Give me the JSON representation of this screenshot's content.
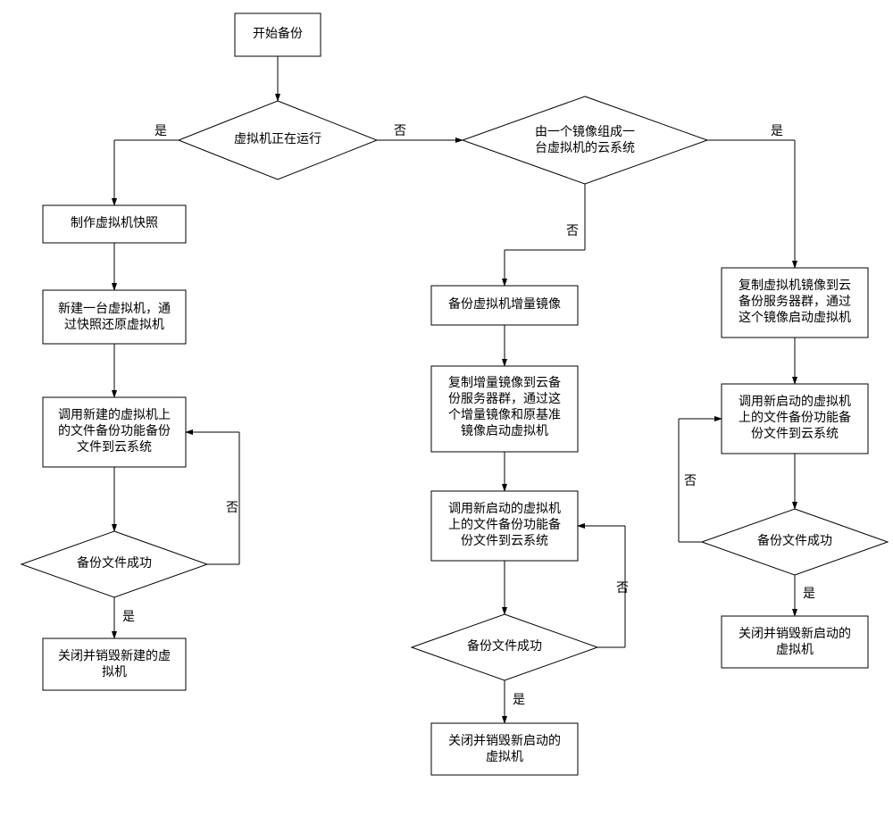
{
  "start": "开始备份",
  "d1": "虚拟机正在运行",
  "d2_line1": "由一个镜像组成一",
  "d2_line2": "台虚拟机的云系统",
  "yes": "是",
  "no": "否",
  "left": {
    "b1": "制作虚拟机快照",
    "b2_l1": "新建一台虚拟机，通",
    "b2_l2": "过快照还原虚拟机",
    "b3_l1": "调用新建的虚拟机上",
    "b3_l2": "的文件备份功能备份",
    "b3_l3": "文件到云系统",
    "d": "备份文件成功",
    "b4_l1": "关闭并销毁新建的虚",
    "b4_l2": "拟机"
  },
  "mid": {
    "b1": "备份虚拟机增量镜像",
    "b2_l1": "复制增量镜像到云备",
    "b2_l2": "份服务器群，通过这",
    "b2_l3": "个增量镜像和原基准",
    "b2_l4": "镜像启动虚拟机",
    "b3_l1": "调用新启动的虚拟机",
    "b3_l2": "上的文件备份功能备",
    "b3_l3": "份文件到云系统",
    "d": "备份文件成功",
    "b4_l1": "关闭并销毁新启动的",
    "b4_l2": "虚拟机"
  },
  "right": {
    "b1_l1": "复制虚拟机镜像到云",
    "b1_l2": "备份服务器群，通过",
    "b1_l3": "这个镜像启动虚拟机",
    "b2_l1": "调用新启动的虚拟机",
    "b2_l2": "上的文件备份功能备",
    "b2_l3": "份文件到云系统",
    "d": "备份文件成功",
    "b3_l1": "关闭并销毁新启动的",
    "b3_l2": "虚拟机"
  }
}
